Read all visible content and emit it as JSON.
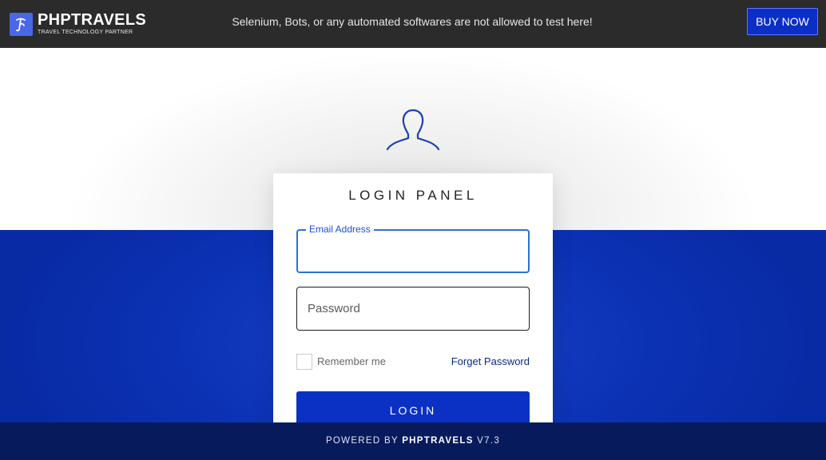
{
  "header": {
    "brand": "PHPTRAVELS",
    "tagline": "TRAVEL TECHNOLOGY PARTNER",
    "notice": "Selenium, Bots, or any automated softwares are not allowed to test here!",
    "buy_label": "BUY NOW",
    "logo_icon": "phptravels-logo-icon"
  },
  "hero": {
    "icon": "user-silhouette-icon"
  },
  "login": {
    "title": "LOGIN PANEL",
    "email_label": "Email Address",
    "email_value": "",
    "password_placeholder": "Password",
    "password_value": "",
    "remember_label": "Remember me",
    "remember_checked": false,
    "forgot_label": "Forget Password",
    "submit_label": "LOGIN"
  },
  "footer": {
    "prefix": "POWERED BY",
    "brand": "PHPTRAVELS",
    "version": "V7.3"
  },
  "colors": {
    "topbar": "#2b2b2b",
    "primary_blue": "#0b31c4",
    "footer": "#071b5c",
    "input_focus": "#2e6fdc"
  }
}
